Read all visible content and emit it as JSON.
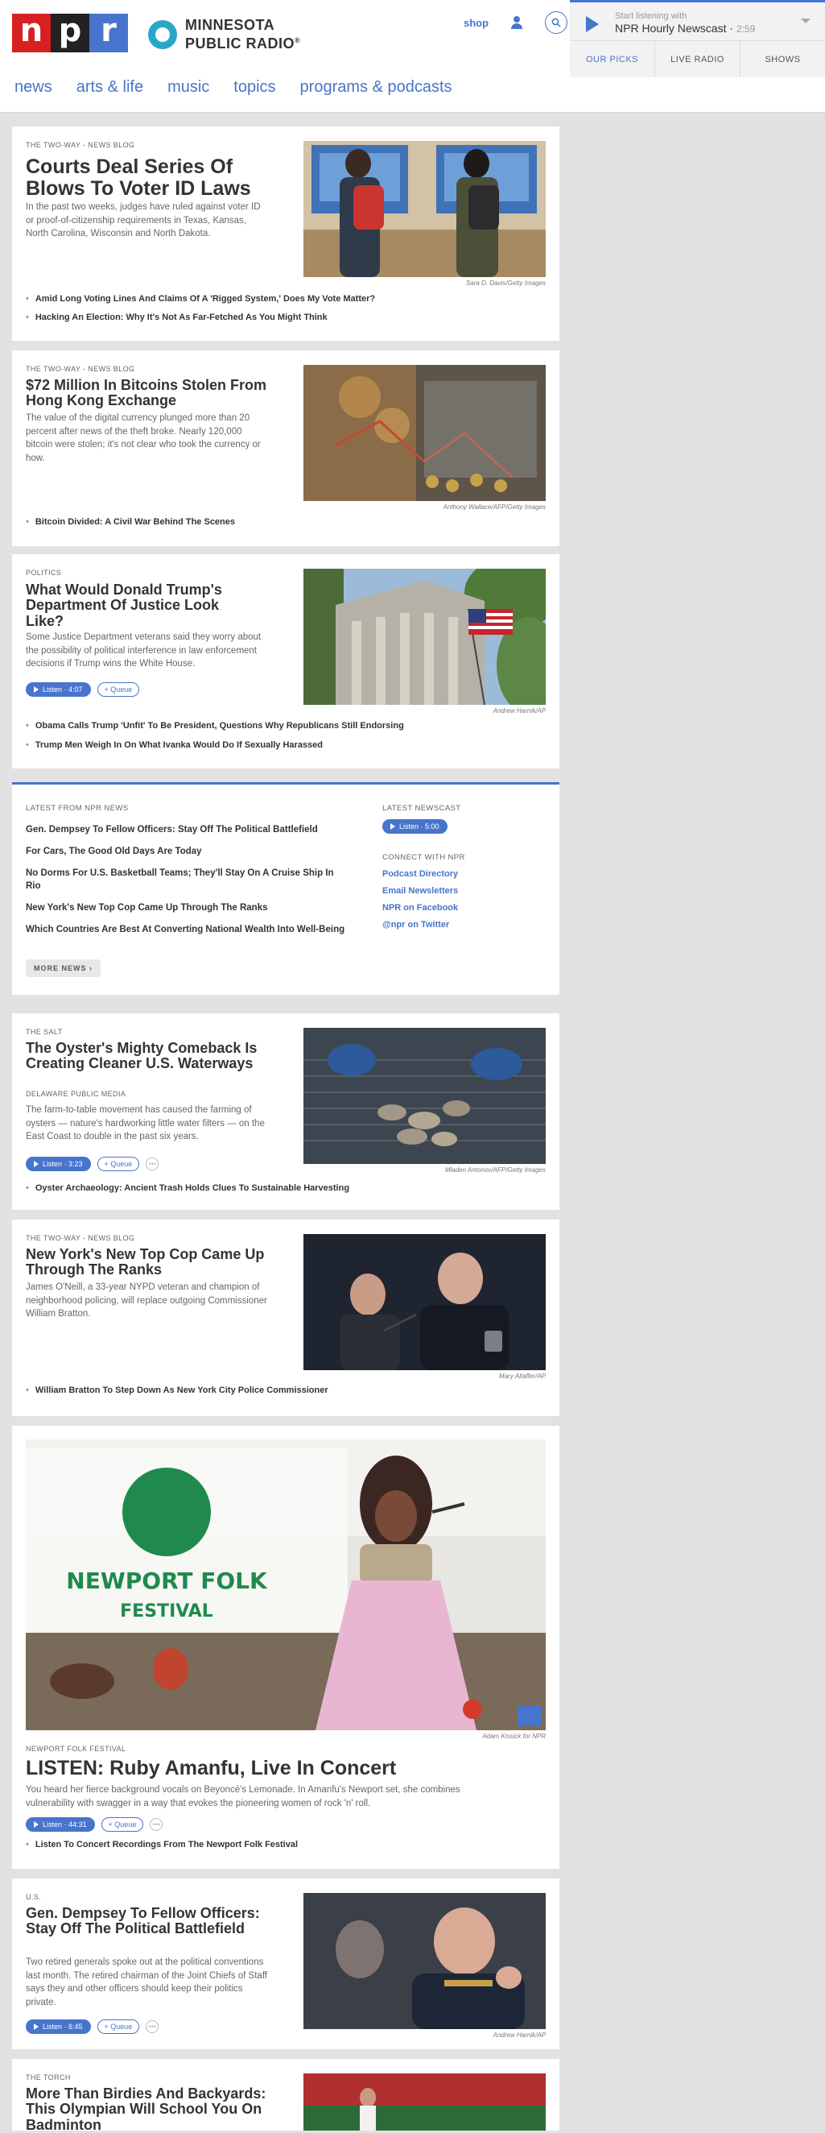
{
  "header": {
    "logo_letters": [
      "n",
      "p",
      "r"
    ],
    "station": "MINNESOTA PUBLIC RADIO",
    "station_line1": "MINNESOTA",
    "station_line2": "PUBLIC RADIO",
    "trademark": "®",
    "shop": "shop",
    "nav": [
      "news",
      "arts & life",
      "music",
      "topics",
      "programs & podcasts"
    ]
  },
  "player": {
    "pre": "Start listening with",
    "title": "NPR Hourly Newscast",
    "duration": "2:59",
    "tabs": [
      "OUR PICKS",
      "LIVE RADIO",
      "SHOWS"
    ]
  },
  "stories": [
    {
      "slug": "THE TWO-WAY - NEWS BLOG",
      "headline": "Courts Deal Series Of Blows To Voter ID Laws",
      "teaser": "In the past two weeks, judges have ruled against voter ID or proof-of-citizenship requirements in Texas, Kansas, North Carolina, Wisconsin and North Dakota.",
      "credit": "Sara D. Davis/Getty Images",
      "related": [
        "Amid Long Voting Lines And Claims Of A 'Rigged System,' Does My Vote Matter?",
        "Hacking An Election: Why It's Not As Far-Fetched As You Might Think"
      ]
    },
    {
      "slug": "THE TWO-WAY - NEWS BLOG",
      "headline": "$72 Million In Bitcoins Stolen From Hong Kong Exchange",
      "teaser": "The value of the digital currency plunged more than 20 percent after news of the theft broke. Nearly 120,000 bitcoin were stolen; it's not clear who took the currency or how.",
      "credit": "Anthony Wallace/AFP/Getty Images",
      "related": [
        "Bitcoin Divided: A Civil War Behind The Scenes"
      ]
    },
    {
      "slug": "POLITICS",
      "headline": "What Would Donald Trump's Department Of Justice Look Like?",
      "teaser": "Some Justice Department veterans said they worry about the possibility of political interference in law enforcement decisions if Trump wins the White House.",
      "listen": "Listen · 4:07",
      "queue": "+ Queue",
      "credit": "Andrew Harnik/AP",
      "related": [
        "Obama Calls Trump 'Unfit' To Be President, Questions Why Republicans Still Endorsing",
        "Trump Men Weigh In On What Ivanka Would Do If Sexually Harassed"
      ]
    },
    {
      "slug": "THE SALT",
      "headline": "The Oyster's Mighty Comeback Is Creating Cleaner U.S. Waterways",
      "byline": "DELAWARE PUBLIC MEDIA",
      "teaser": "The farm-to-table movement has caused the farming of oysters — nature's hardworking little water filters — on the East Coast to double in the past six years.",
      "listen": "Listen · 3:23",
      "queue": "+ Queue",
      "credit": "Mladen Antonov/AFP/Getty Images",
      "related": [
        "Oyster Archaeology: Ancient Trash Holds Clues To Sustainable Harvesting"
      ]
    },
    {
      "slug": "THE TWO-WAY - NEWS BLOG",
      "headline": "New York's New Top Cop Came Up Through The Ranks",
      "teaser": "James O'Neill, a 33-year NYPD veteran and champion of neighborhood policing, will replace outgoing Commissioner William Bratton.",
      "credit": "Mary Altaffer/AP",
      "related": [
        "William Bratton To Step Down As New York City Police Commissioner"
      ]
    },
    {
      "slug": "NEWPORT FOLK FESTIVAL",
      "headline": "LISTEN: Ruby Amanfu, Live In Concert",
      "teaser": "You heard her fierce background vocals on Beyoncé's Lemonade. In Amanfu's Newport set, she combines vulnerability with swagger in a way that evokes the pioneering women of rock 'n' roll.",
      "listen": "Listen · 44:31",
      "queue": "+ Queue",
      "credit": "Adam Kissick for NPR",
      "photo_sign_line1": "NEWPORT FOLK",
      "photo_sign_line2": "FESTIVAL",
      "related": [
        "Listen To Concert Recordings From The Newport Folk Festival"
      ]
    },
    {
      "slug": "U.S.",
      "headline": "Gen. Dempsey To Fellow Officers: Stay Off The Political Battlefield",
      "teaser": "Two retired generals spoke out at the political conventions last month. The retired chairman of the Joint Chiefs of Staff says they and other officers should keep their politics private.",
      "listen": "Listen · 6:45",
      "queue": "+ Queue",
      "credit": "Andrew Harnik/AP"
    },
    {
      "slug": "THE TORCH",
      "headline": "More Than Birdies And Backyards: This Olympian Will School You On Badminton"
    }
  ],
  "latest": {
    "label": "LATEST FROM NPR NEWS",
    "items": [
      "Gen. Dempsey To Fellow Officers: Stay Off The Political Battlefield",
      "For Cars, The Good Old Days Are Today",
      "No Dorms For U.S. Basketball Teams; They'll Stay On A Cruise Ship In Rio",
      "New York's New Top Cop Came Up Through The Ranks",
      "Which Countries Are Best At Converting National Wealth Into Well-Being"
    ],
    "more": "MORE NEWS ›",
    "newscast_label": "LATEST NEWSCAST",
    "newscast_listen": "Listen · 5:00",
    "connect_label": "CONNECT WITH NPR",
    "connect_links": [
      "Podcast Directory",
      "Email Newsletters",
      "NPR on Facebook",
      "@npr on Twitter"
    ]
  },
  "colors": {
    "accent": "#4774cc",
    "npr_red": "#d62021",
    "npr_black": "#222222",
    "mpr_blue": "#2ba6cb"
  }
}
